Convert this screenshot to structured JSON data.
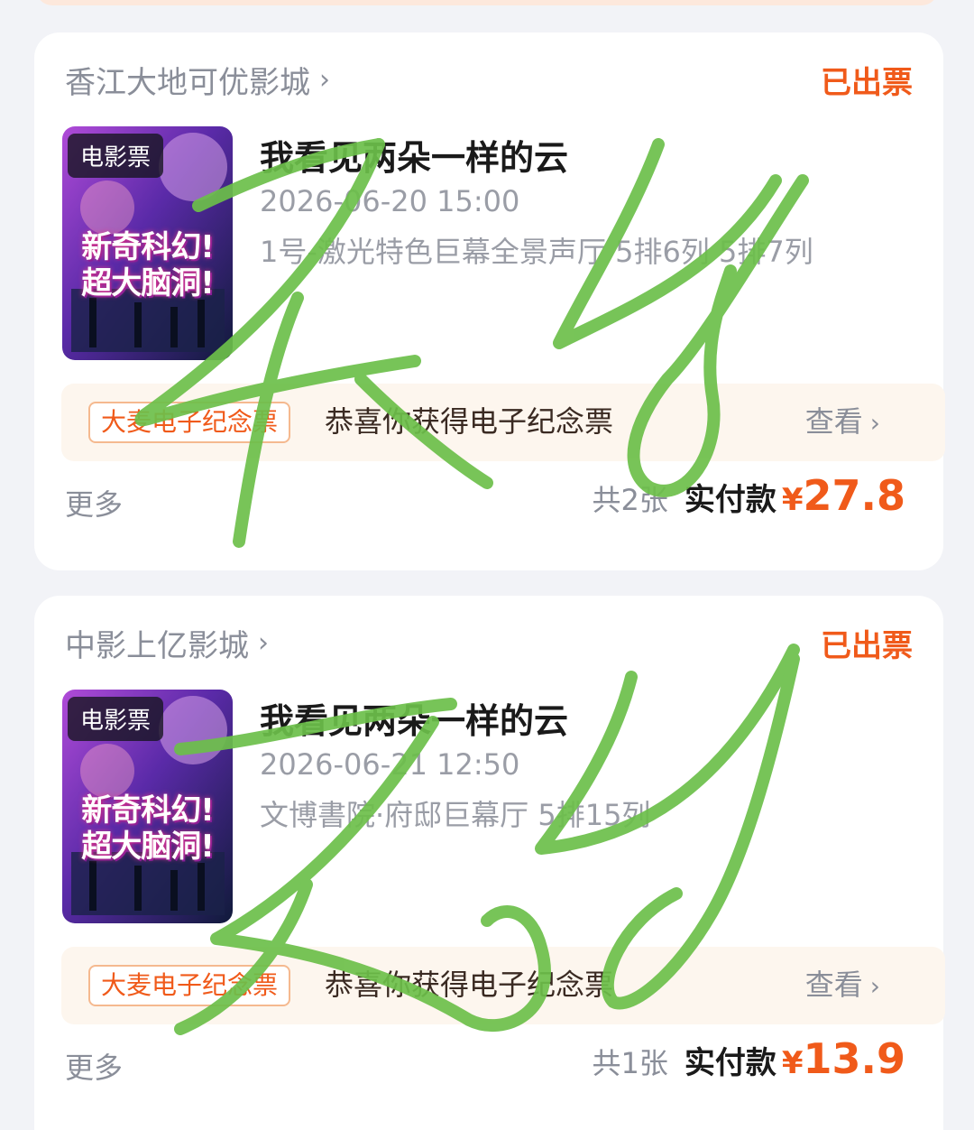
{
  "orders": [
    {
      "cinema": "香江大地可优影城",
      "status": "已出票",
      "poster_badge": "电影票",
      "poster_slogan_1": "新奇科幻!",
      "poster_slogan_2": "超大脑洞!",
      "movie_title": "我看见两朵一样的云",
      "show_time": "2026-06-20 15:00",
      "hall_seat": "1号-激光特色巨幕全景声厅 5排6列 5排7列",
      "souvenir_tag": "大麦电子纪念票",
      "souvenir_text": "恭喜你获得电子纪念票",
      "souvenir_view": "查看",
      "more": "更多",
      "ticket_count": "共2张",
      "paid_label": "实付款",
      "currency": "¥",
      "amount": "27.8"
    },
    {
      "cinema": "中影上亿影城",
      "status": "已出票",
      "poster_badge": "电影票",
      "poster_slogan_1": "新奇科幻!",
      "poster_slogan_2": "超大脑洞!",
      "movie_title": "我看见两朵一样的云",
      "show_time": "2026-06-21 12:50",
      "hall_seat": "文博書院·府邸巨幕厅 5排15列",
      "souvenir_tag": "大麦电子纪念票",
      "souvenir_text": "恭喜你获得电子纪念票",
      "souvenir_view": "查看",
      "more": "更多",
      "ticket_count": "共1张",
      "paid_label": "实付款",
      "currency": "¥",
      "amount": "13.9"
    }
  ],
  "colors": {
    "accent": "#f05a1a",
    "scribble": "#6cbf4a",
    "background": "#f2f3f7"
  }
}
